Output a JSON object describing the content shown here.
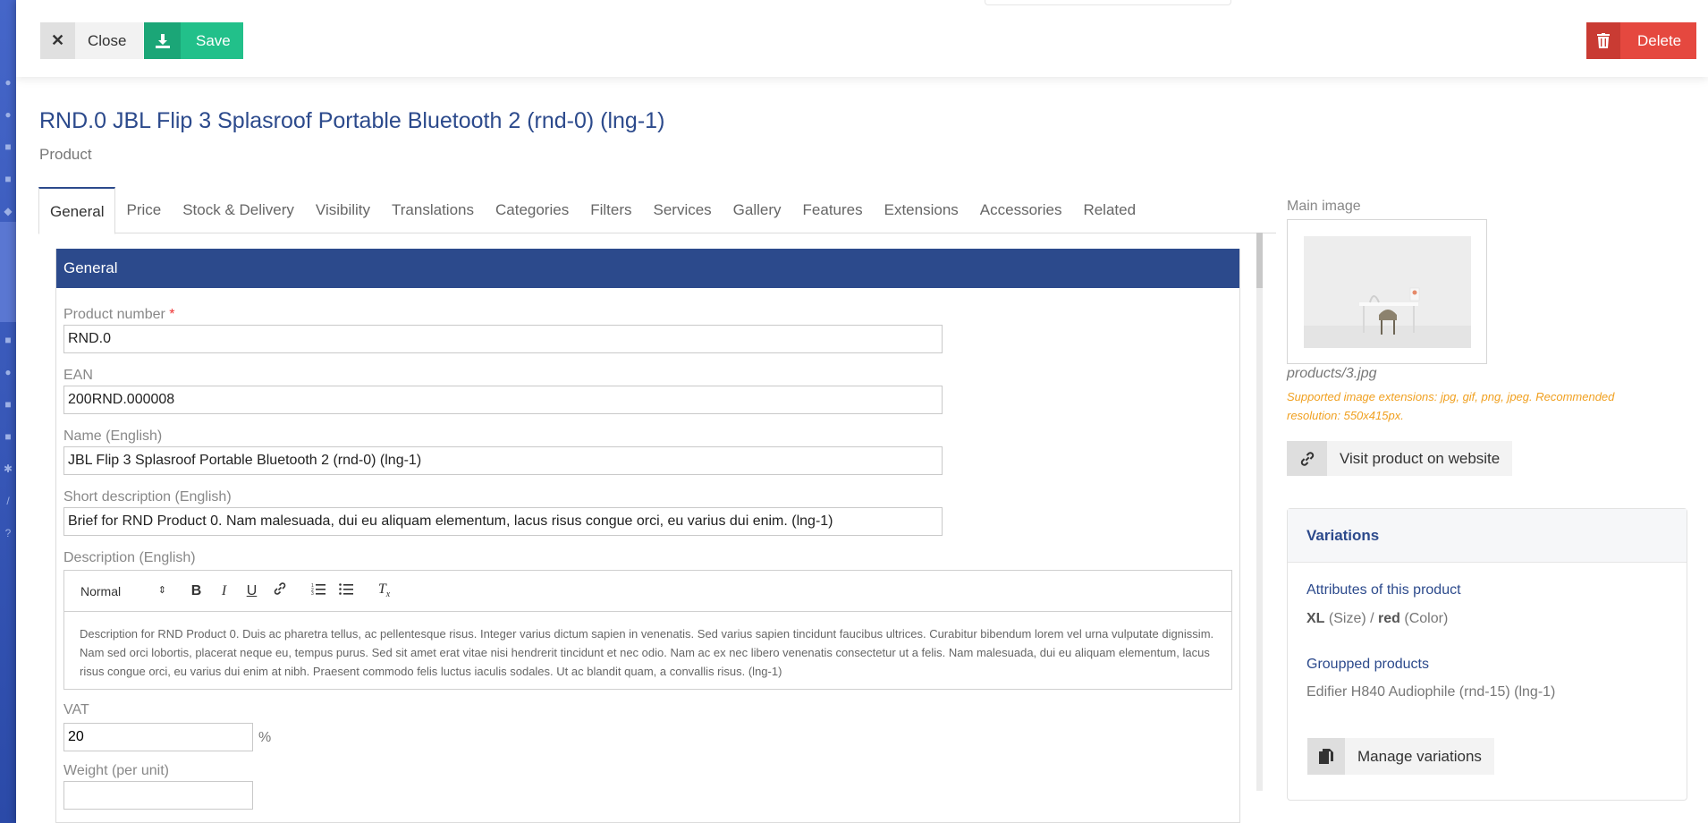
{
  "toolbar": {
    "close_label": "Close",
    "save_label": "Save",
    "delete_label": "Delete"
  },
  "header": {
    "title": "RND.0 JBL Flip 3 Splasroof Portable Bluetooth 2 (rnd-0) (lng-1)",
    "subtitle": "Product"
  },
  "tabs": [
    "General",
    "Price",
    "Stock & Delivery",
    "Visibility",
    "Translations",
    "Categories",
    "Filters",
    "Services",
    "Gallery",
    "Features",
    "Extensions",
    "Accessories",
    "Related"
  ],
  "form": {
    "section_title": "General",
    "product_number": {
      "label": "Product number",
      "required_mark": "*",
      "value": "RND.0"
    },
    "ean": {
      "label": "EAN",
      "value": "200RND.000008"
    },
    "name": {
      "label": "Name (English)",
      "value": "JBL Flip 3 Splasroof Portable Bluetooth 2 (rnd-0) (lng-1)"
    },
    "short_description": {
      "label": "Short description (English)",
      "value": "Brief for RND Product 0. Nam malesuada, dui eu aliquam elementum, lacus risus congue orci, eu varius dui enim. (lng-1)"
    },
    "description": {
      "label": "Description (English)",
      "format_select": "Normal",
      "value": "Description for RND Product 0. Duis ac pharetra tellus, ac pellentesque risus. Integer varius dictum sapien in venenatis. Sed varius sapien tincidunt faucibus ultrices. Curabitur bibendum lorem vel urna vulputate dignissim. Nam sed orci lobortis, placerat neque eu, tempus purus. Sed sit amet erat vitae nisi hendrerit tincidunt et nec odio. Nam ac ex nec libero venenatis consectetur ut a felis. Nam malesuada, dui eu aliquam elementum, lacus risus congue orci, eu varius dui enim at nibh. Praesent commodo felis luctus iaculis sodales. Ut ac blandit quam, a convallis risus. (lng-1)"
    },
    "vat": {
      "label": "VAT",
      "value": "20",
      "unit": "%"
    },
    "weight": {
      "label": "Weight (per unit)"
    }
  },
  "main_image": {
    "label": "Main image",
    "filename": "products/3.jpg",
    "hint": "Supported image extensions: jpg, gif, png, jpeg. Recommended resolution: 550x415px."
  },
  "visit_label": "Visit product on website",
  "variations": {
    "title": "Variations",
    "attributes_heading": "Attributes of this product",
    "attr_size_value": "XL",
    "attr_size_name": "(Size) /",
    "attr_color_value": "red",
    "attr_color_name": "(Color)",
    "grouped_heading": "Groupped products",
    "grouped_item": "Edifier H840 Audiophile (rnd-15) (lng-1)",
    "manage_label": "Manage variations"
  },
  "icons": {
    "close": "close-icon",
    "save": "download-icon",
    "delete": "trash-icon",
    "visit": "link-icon",
    "manage": "copy-icon"
  }
}
